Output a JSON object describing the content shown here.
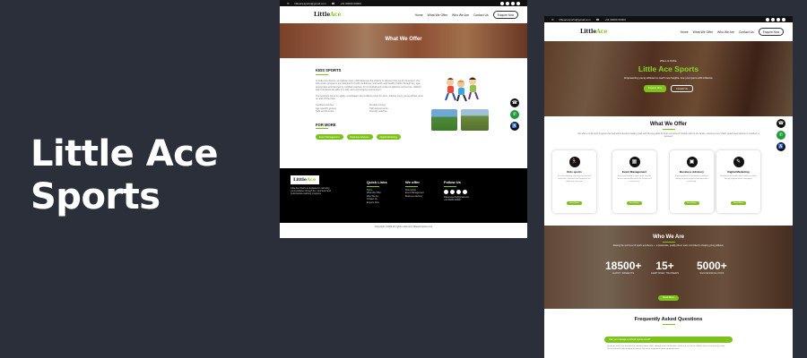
{
  "headline": "Little Ace Sports",
  "colors": {
    "background": "#2a2f3a",
    "accent": "#7cc219",
    "dark": "#111111"
  },
  "shot_a": {
    "topbar": {
      "email": "littleacesports@gmail.com",
      "phone": "+91 90000 00000"
    },
    "logo": {
      "main": "Little",
      "accent": "Ace"
    },
    "nav": [
      "Home",
      "What We Offer",
      "Who We Are",
      "Contact Us"
    ],
    "enquire_button": "Enquire Now",
    "banner_title": "What We Offer",
    "section_title": "KIDS SPORTS",
    "section_text": "At Little Ace Sports, we believe every child deserves the chance to discover the joy of movement. Our kids sports programs are designed to build confidence, teamwork and healthy habits through fun, age-appropriate activities led by certified coaches. From football and cricket to athletics and tennis, children learn fundamental skills in a safe and encouraging environment.",
    "section_text_2": "Our sessions focus on agility, coordination and a lifelong love for sport, helping every young athlete grow on and off the field.",
    "bullets": [
      "Certified coaches",
      "Age-specific groups",
      "Safe environment",
      "Flexible timings",
      "Skill assessments",
      "Friendly matches"
    ],
    "for_more": "FOR MORE",
    "more_buttons": [
      "Event Management",
      "Business Advisory",
      "Digital Marketing"
    ],
    "footer": {
      "about": "Little Ace Sports is dedicated to nurturing young athletes through fun, structured and professional coaching programs.",
      "quick_links_title": "Quick Links",
      "quick_links": [
        "Home",
        "What We Offer",
        "Who We Are",
        "Contact Us",
        "Enquire Now"
      ],
      "we_offer_title": "We offer",
      "we_offer": [
        "Kids sports",
        "Event Management",
        "Business Advisory"
      ],
      "follow_title": "Follow Us",
      "copyright": "Copyright ©2024 All rights reserved | littleacesports.com"
    }
  },
  "shot_b": {
    "topbar": {
      "email": "littleacesports@gmail.com",
      "phone": "+91 90000 00000"
    },
    "logo": {
      "main": "Little",
      "accent": "Ace"
    },
    "nav": [
      "Home",
      "What We Offer",
      "Who We Are",
      "Contact Us"
    ],
    "enquire_button": "Enquire Now",
    "hero": {
      "welcome": "WELCOME",
      "title": "Little Ace Sports",
      "subtitle": "Empowering young athletes to reach new heights. Ace your game with LittleAce",
      "btn_primary": "Enquire Now",
      "btn_secondary": "Contact Us"
    },
    "offer": {
      "title": "What We Offer",
      "intro": "We offer a multi-sport program that helps kids develop healthy goals and life-long skills through a structured, flexible plan for the family, ensuring every child's growth and passion is coached to succeed.",
      "cards": [
        {
          "title": "Kids sports",
          "icon": "running-kid-icon",
          "desc": "Fun and engaging coaching sessions that build skills, teamwork and confidence for children of every age.",
          "btn": "Read More"
        },
        {
          "title": "Event Management",
          "icon": "calendar-icon",
          "desc": "From tournaments to sports days, we plan and run memorable events for schools and communities.",
          "btn": "Read More"
        },
        {
          "title": "Business Advisory",
          "icon": "briefcase-icon",
          "desc": "Expert guidance for academies and clubs looking to grow programs and operations sustainably.",
          "btn": "Read More"
        },
        {
          "title": "Digital Marketing",
          "icon": "megaphone-icon",
          "desc": "Helping sports brands reach families and fans through targeted online campaigns.",
          "btn": "Read More"
        }
      ]
    },
    "who": {
      "title": "Who We Are",
      "intro": "Raising the next level of sports excellence — a passionate, quality-driven team committed to shaping young athletes.",
      "stats": [
        {
          "value": "18500+",
          "label": "HAPPY PARENTS"
        },
        {
          "value": "15+",
          "label": "CERTIFIED TRAINERS"
        },
        {
          "value": "5000+",
          "label": "SUCCESSFUL KIDS"
        }
      ],
      "btn": "Read More"
    },
    "faq": {
      "title": "Frequently Asked Questions",
      "question": "Can you manage a school sports event?",
      "answer": "Sports activities are designed to enhance motor skills, strength and coordination, which are crucial for children who are physically active. These activities help develop a positive, fun and a supportive future sporting career."
    }
  }
}
